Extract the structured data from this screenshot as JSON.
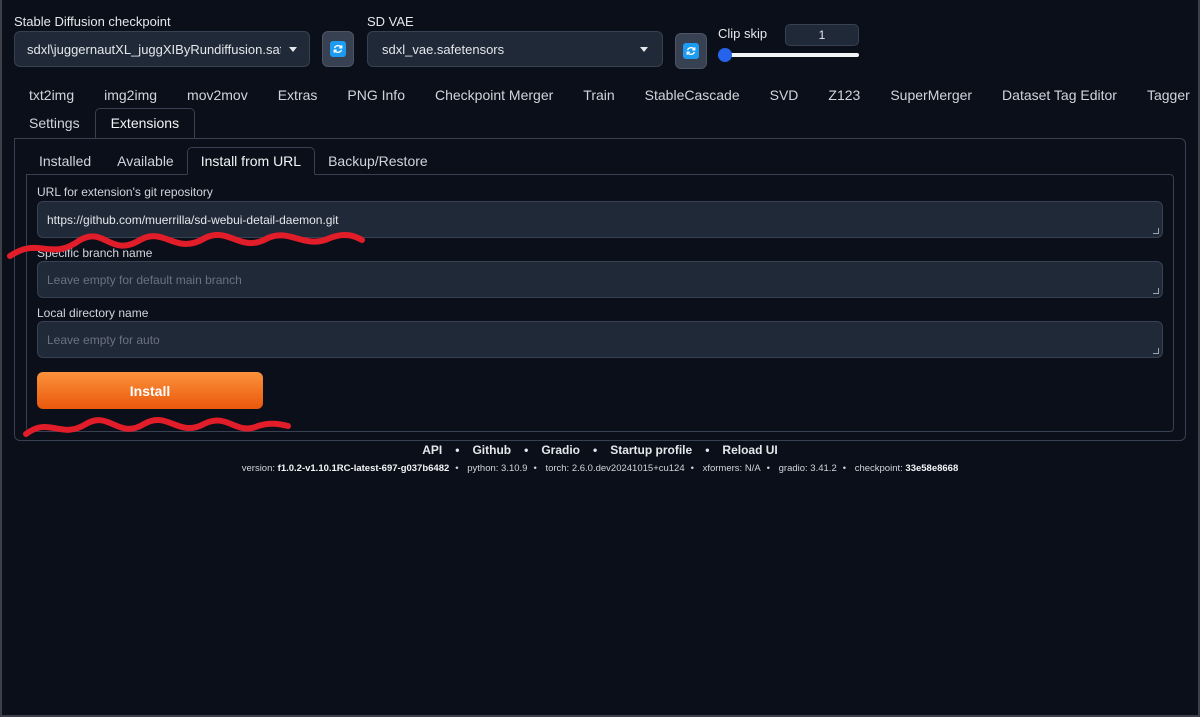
{
  "checkpoint": {
    "label": "Stable Diffusion checkpoint",
    "value": "sdxl\\juggernautXL_juggXIByRundiffusion.safetensors"
  },
  "vae": {
    "label": "SD VAE",
    "value": "sdxl_vae.safetensors"
  },
  "clip_skip": {
    "label": "Clip skip",
    "value": "1",
    "slider_fraction": 0.0
  },
  "main_tabs": {
    "row1": [
      "txt2img",
      "img2img",
      "mov2mov",
      "Extras",
      "PNG Info",
      "Checkpoint Merger",
      "Train",
      "StableCascade",
      "SVD",
      "Z123",
      "SuperMerger",
      "Dataset Tag Editor",
      "Tagger"
    ],
    "row2": [
      "Settings",
      "Extensions"
    ],
    "active": "Extensions"
  },
  "sub_tabs": {
    "items": [
      "Installed",
      "Available",
      "Install from URL",
      "Backup/Restore"
    ],
    "active": "Install from URL"
  },
  "form": {
    "url_label": "URL for extension's git repository",
    "url_value": "https://github.com/muerrilla/sd-webui-detail-daemon.git",
    "branch_label": "Specific branch name",
    "branch_placeholder": "Leave empty for default main branch",
    "dir_label": "Local directory name",
    "dir_placeholder": "Leave empty for auto",
    "install_label": "Install"
  },
  "footer": {
    "links": [
      "API",
      "Github",
      "Gradio",
      "Startup profile",
      "Reload UI"
    ],
    "version_label": "version:",
    "version": "f1.0.2-v1.10.1RC-latest-697-g037b6482",
    "python": "python: 3.10.9",
    "torch": "torch: 2.6.0.dev20241015+cu124",
    "xformers": "xformers: N/A",
    "gradio": "gradio: 3.41.2",
    "checkpoint_label": "checkpoint:",
    "checkpoint": "33e58e8668"
  },
  "colors": {
    "background": "#0b0f19",
    "accent_orange": "#f97316",
    "refresh_blue": "#1d9bf0",
    "scribble_red": "#e11d2a"
  },
  "icons": [
    "refresh-icon",
    "chevron-down-icon",
    "resize-grip-icon"
  ]
}
